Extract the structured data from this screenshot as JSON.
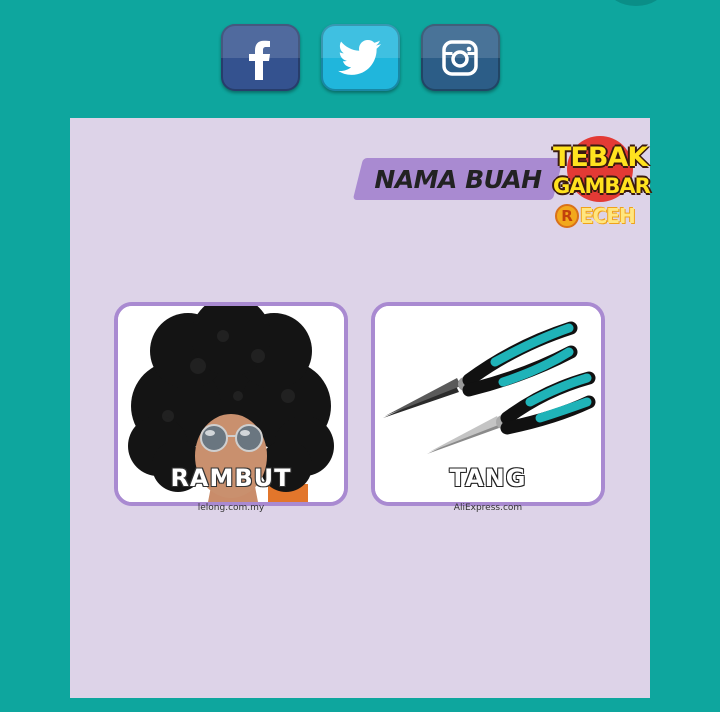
{
  "social": {
    "facebook": {
      "icon": "facebook-icon",
      "color": "#34528f"
    },
    "twitter": {
      "icon": "twitter-icon",
      "color": "#20b6dc"
    },
    "instagram": {
      "icon": "instagram-icon",
      "color": "#2c5d87"
    }
  },
  "card": {
    "category": "NAMA BUAH",
    "logo": {
      "line1": "TEBAK",
      "line2": "GAMBAR",
      "line3_badge": "R",
      "line3": "ECEH"
    },
    "tiles": [
      {
        "label": "RAMBUT",
        "credit": "lelong.com.my",
        "image": "afro-wig-photo"
      },
      {
        "label": "TANG",
        "credit": "AliExpress.com",
        "image": "pliers-photo"
      }
    ]
  },
  "colors": {
    "background": "#0ea69e",
    "card": "#ddd3e8",
    "accent": "#a98ad1"
  }
}
